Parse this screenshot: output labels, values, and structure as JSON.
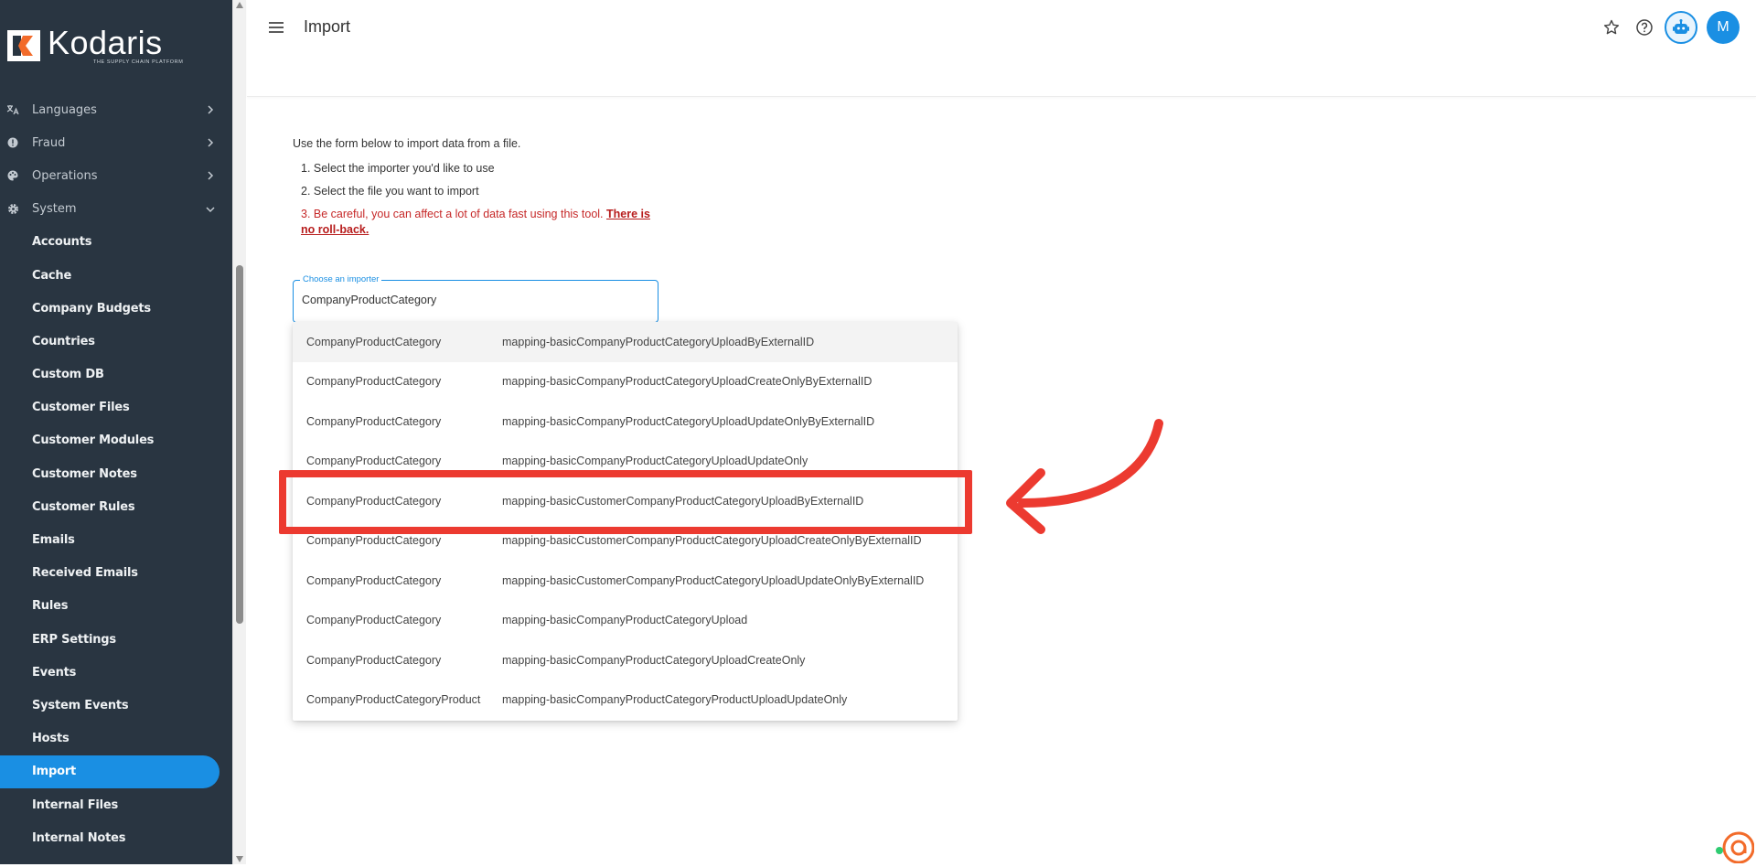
{
  "brand": {
    "name": "Kodaris",
    "tagline": "THE SUPPLY CHAIN PLATFORM"
  },
  "sidebar": {
    "groups": [
      {
        "label": "Languages",
        "icon": "translate-icon"
      },
      {
        "label": "Fraud",
        "icon": "alert-icon"
      },
      {
        "label": "Operations",
        "icon": "palette-icon"
      },
      {
        "label": "System",
        "icon": "gear-icon",
        "expanded": true
      }
    ],
    "items": [
      {
        "label": "Accounts"
      },
      {
        "label": "Cache"
      },
      {
        "label": "Company Budgets"
      },
      {
        "label": "Countries"
      },
      {
        "label": "Custom DB"
      },
      {
        "label": "Customer Files"
      },
      {
        "label": "Customer Modules"
      },
      {
        "label": "Customer Notes"
      },
      {
        "label": "Customer Rules"
      },
      {
        "label": "Emails"
      },
      {
        "label": "Received Emails"
      },
      {
        "label": "Rules"
      },
      {
        "label": "ERP Settings"
      },
      {
        "label": "Events"
      },
      {
        "label": "System Events"
      },
      {
        "label": "Hosts"
      },
      {
        "label": "Import",
        "active": true
      },
      {
        "label": "Internal Files"
      },
      {
        "label": "Internal Notes"
      }
    ]
  },
  "header": {
    "title": "Import",
    "avatar_initial": "M"
  },
  "form": {
    "intro": "Use the form below to import data from a file.",
    "step1": "1. Select the importer you'd like to use",
    "step2": "2. Select the file you want to import",
    "step3_text": "3. Be careful, you can affect a lot of data fast using this tool. ",
    "step3_link": "There is no roll-back.",
    "importer_label": "Choose an importer",
    "importer_value": "CompanyProductCategory"
  },
  "options": [
    {
      "entity": "CompanyProductCategory",
      "mapping": "mapping-basicCompanyProductCategoryUploadByExternalID"
    },
    {
      "entity": "CompanyProductCategory",
      "mapping": "mapping-basicCompanyProductCategoryUploadCreateOnlyByExternalID"
    },
    {
      "entity": "CompanyProductCategory",
      "mapping": "mapping-basicCompanyProductCategoryUploadUpdateOnlyByExternalID"
    },
    {
      "entity": "CompanyProductCategory",
      "mapping": "mapping-basicCompanyProductCategoryUploadUpdateOnly"
    },
    {
      "entity": "CompanyProductCategory",
      "mapping": "mapping-basicCustomerCompanyProductCategoryUploadByExternalID"
    },
    {
      "entity": "CompanyProductCategory",
      "mapping": "mapping-basicCustomerCompanyProductCategoryUploadCreateOnlyByExternalID"
    },
    {
      "entity": "CompanyProductCategory",
      "mapping": "mapping-basicCustomerCompanyProductCategoryUploadUpdateOnlyByExternalID"
    },
    {
      "entity": "CompanyProductCategory",
      "mapping": "mapping-basicCompanyProductCategoryUpload"
    },
    {
      "entity": "CompanyProductCategory",
      "mapping": "mapping-basicCompanyProductCategoryUploadCreateOnly"
    },
    {
      "entity": "CompanyProductCategoryProduct",
      "mapping": "mapping-basicCompanyProductCategoryProductUploadUpdateOnly"
    }
  ],
  "colors": {
    "accent": "#1a8fe3",
    "sidebar_bg": "#293541",
    "annotation": "#ec3a30",
    "warning": "#c62828"
  }
}
